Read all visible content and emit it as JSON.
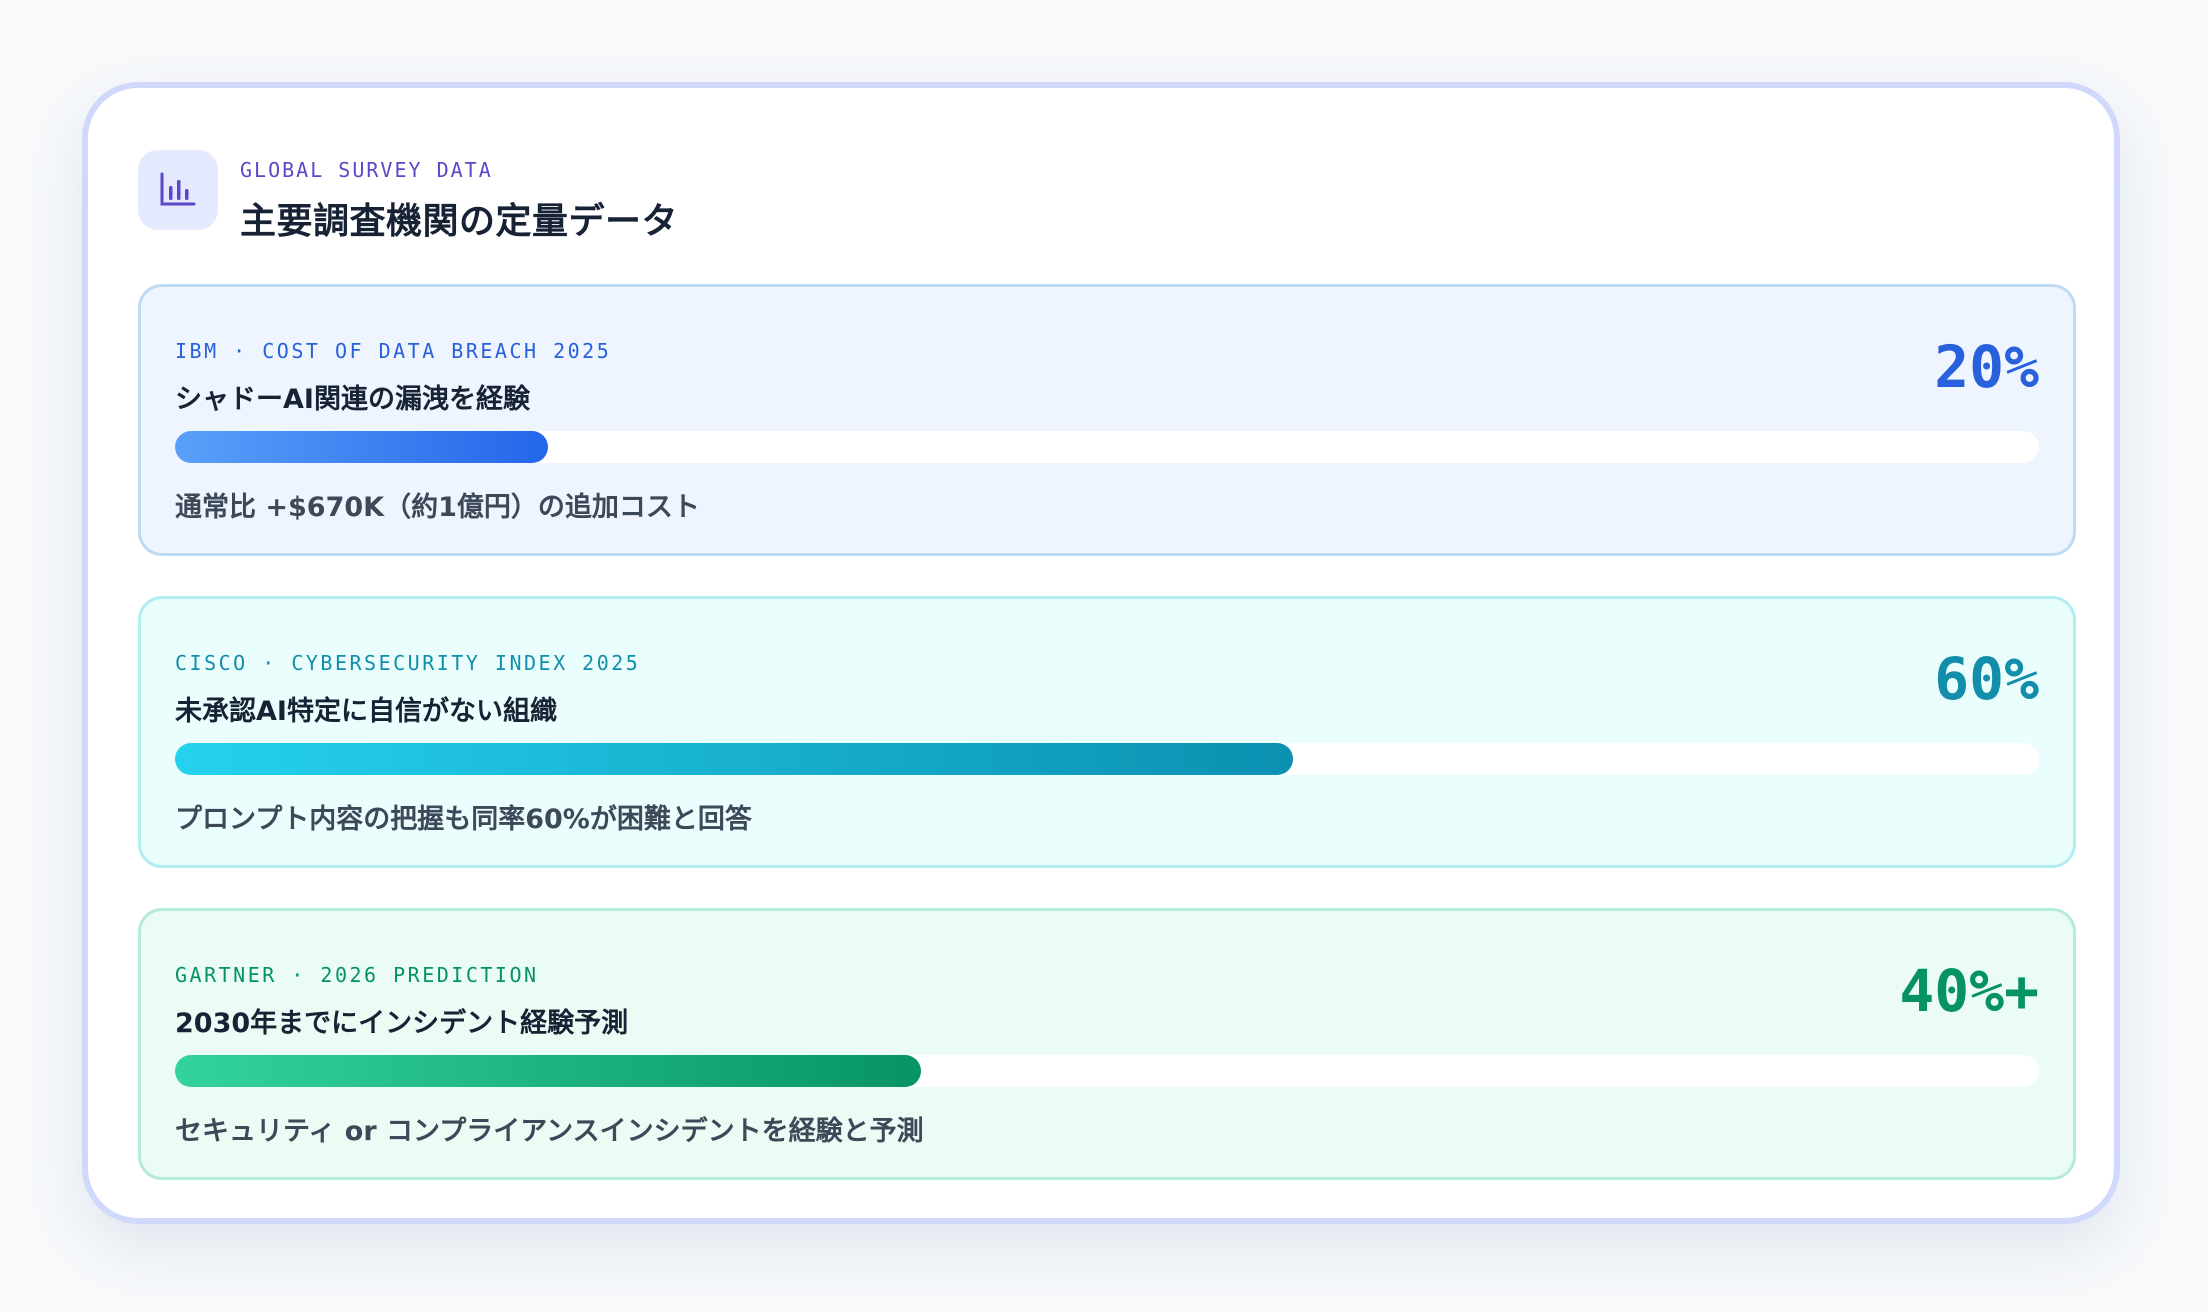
{
  "header": {
    "icon": "bar-chart-icon",
    "eyebrow": "GLOBAL SURVEY DATA",
    "title": "主要調査機関の定量データ"
  },
  "stats": [
    {
      "source": "IBM · COST OF DATA BREACH 2025",
      "headline": "シャドーAI関連の漏洩を経験",
      "value_label": "20%",
      "value_percent": 20,
      "note": "通常比 +$670K（約1億円）の追加コスト",
      "accent": "#2563eb"
    },
    {
      "source": "CISCO · CYBERSECURITY INDEX 2025",
      "headline": "未承認AI特定に自信がない組織",
      "value_label": "60%",
      "value_percent": 60,
      "note": "プロンプト内容の把握も同率60%が困難と回答",
      "accent": "#0e94b4"
    },
    {
      "source": "GARTNER · 2026 PREDICTION",
      "headline": "2030年までにインシデント経験予測",
      "value_label": "40%+",
      "value_percent": 40,
      "note": "セキュリティ or コンプライアンスインシデントを経験と予測",
      "accent": "#059669"
    }
  ]
}
